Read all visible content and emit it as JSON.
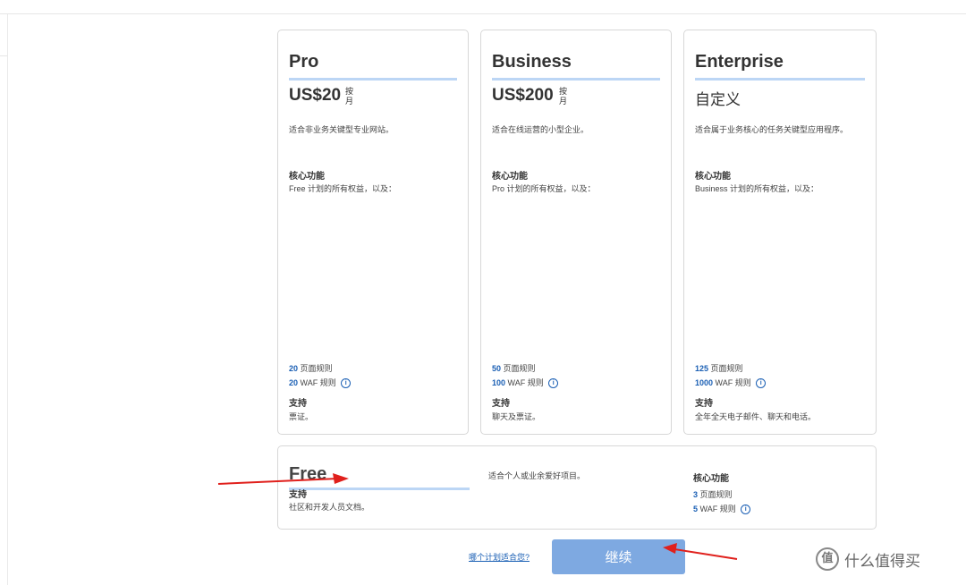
{
  "plans": [
    {
      "name": "Pro",
      "price": "US$20",
      "unit": "按月",
      "description": "适合非业务关键型专业网站。",
      "core_title": "核心功能",
      "core_sub": "Free 计划的所有权益，以及：",
      "page_rules_count": "20",
      "page_rules_label": "页面规则",
      "waf_rules_count": "20",
      "waf_rules_label": "WAF 规则",
      "support_title": "支持",
      "support_text": "票证。"
    },
    {
      "name": "Business",
      "price": "US$200",
      "unit": "按月",
      "description": "适合在线运营的小型企业。",
      "core_title": "核心功能",
      "core_sub": "Pro 计划的所有权益，以及：",
      "page_rules_count": "50",
      "page_rules_label": "页面规则",
      "waf_rules_count": "100",
      "waf_rules_label": "WAF 规则",
      "support_title": "支持",
      "support_text": "聊天及票证。"
    },
    {
      "name": "Enterprise",
      "price": "自定义",
      "description": "适合属于业务核心的任务关键型应用程序。",
      "core_title": "核心功能",
      "core_sub": "Business 计划的所有权益，以及：",
      "page_rules_count": "125",
      "page_rules_label": "页面规则",
      "waf_rules_count": "1000",
      "waf_rules_label": "WAF 规则",
      "support_title": "支持",
      "support_text": "全年全天电子邮件、聊天和电话。"
    }
  ],
  "free_plan": {
    "name": "Free",
    "support_title": "支持",
    "support_text": "社区和开发人员文档。",
    "description": "适合个人或业余爱好项目。",
    "core_title": "核心功能",
    "page_rules_count": "3",
    "page_rules_label": "页面规则",
    "waf_rules_count": "5",
    "waf_rules_label": "WAF 规则"
  },
  "footer": {
    "help_link": "哪个计划适合您?",
    "continue_label": "继续"
  },
  "watermark": {
    "icon_text": "值",
    "text": "什么值得买"
  },
  "colors": {
    "accent_link": "#1a5fb4",
    "rule_bar": "#bcd6f5",
    "continue_button": "#7ea9e1",
    "annotation_arrow": "#e0201c"
  },
  "icons": {
    "info": "info-circle-icon",
    "annotation": "red-arrow-icon"
  }
}
